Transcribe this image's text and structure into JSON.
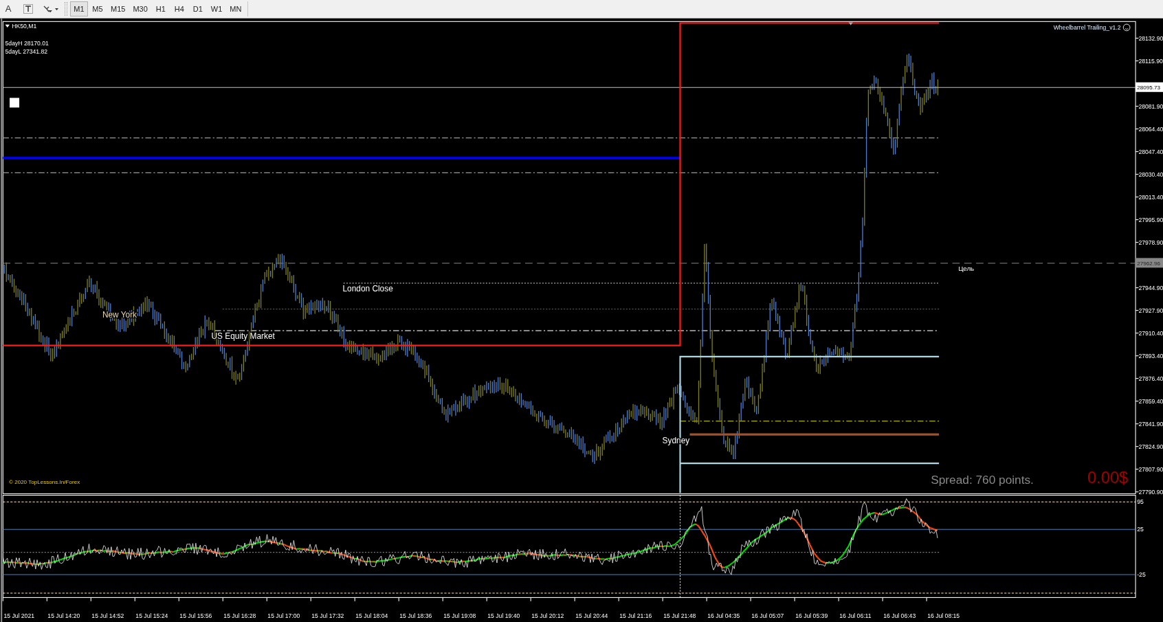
{
  "toolbar": {
    "text_tool": "A",
    "timeframes": [
      {
        "label": "M1",
        "selected": true
      },
      {
        "label": "M5",
        "selected": false
      },
      {
        "label": "M15",
        "selected": false
      },
      {
        "label": "M30",
        "selected": false
      },
      {
        "label": "H1",
        "selected": false
      },
      {
        "label": "H4",
        "selected": false
      },
      {
        "label": "D1",
        "selected": false
      },
      {
        "label": "W1",
        "selected": false
      },
      {
        "label": "MN",
        "selected": false
      }
    ]
  },
  "chart": {
    "symbol": "HK50,M1",
    "info_lines": [
      "5dayH 28170.01",
      "5dayL 27341.82"
    ],
    "expert": "Wheelbarrel Trailing_v1.2",
    "session_labels": [
      "London Close",
      "New York",
      "US Equity Market",
      "Sydney"
    ],
    "target_label": "Цель",
    "copyright": "© 2020 TopLessons.In/Forex",
    "spread": "Spread: 760 points.",
    "profit": "0.00$"
  },
  "price_axis": {
    "ticks": [
      "28132.90",
      "28115.90",
      "28081.90",
      "28064.40",
      "28047.40",
      "28030.40",
      "28013.40",
      "27995.90",
      "27978.90",
      "27944.90",
      "27927.90",
      "27910.40",
      "27893.40",
      "27876.40",
      "27859.40",
      "27841.90",
      "27824.90",
      "27807.90",
      "27790.90"
    ],
    "current_price": "28095.73",
    "target_price": "27962.96"
  },
  "indicator_axis": [
    "95",
    "25",
    "-25"
  ],
  "time_axis": [
    "15 Jul 2021",
    "15 Jul 14:20",
    "15 Jul 14:52",
    "15 Jul 15:24",
    "15 Jul 15:56",
    "15 Jul 16:28",
    "15 Jul 17:00",
    "15 Jul 17:32",
    "15 Jul 18:04",
    "15 Jul 18:36",
    "15 Jul 19:08",
    "15 Jul 19:40",
    "15 Jul 20:12",
    "15 Jul 20:44",
    "15 Jul 21:16",
    "15 Jul 21:48",
    "16 Jul 04:35",
    "16 Jul 05:07",
    "16 Jul 05:39",
    "16 Jul 06:11",
    "16 Jul 06:43",
    "16 Jul 08:15"
  ]
}
